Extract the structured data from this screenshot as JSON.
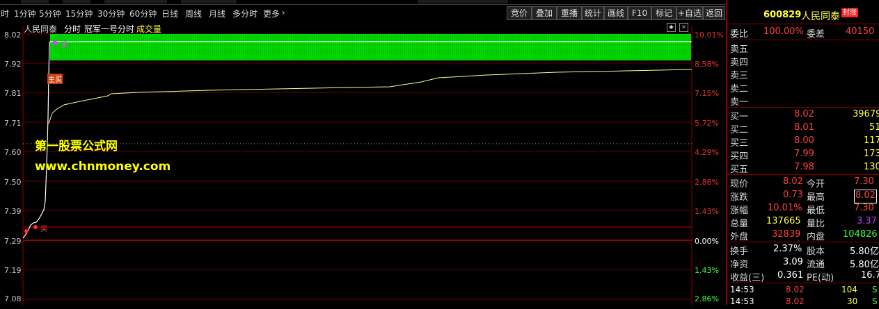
{
  "menu": {
    "prefix": "时",
    "items": [
      "1分钟",
      "5分钟",
      "15分钟",
      "30分钟",
      "60分钟",
      "日线",
      "周线",
      "月线",
      "多分时",
      "更多"
    ],
    "more_arrow": "›",
    "right_buttons": [
      "竞价",
      "叠加",
      "重播",
      "统计",
      "画线",
      "F10",
      "标记",
      "+自选",
      "返回"
    ]
  },
  "title_row": {
    "stock": "人民同泰",
    "mode": "分时",
    "indicator": "冠军一号分时",
    "volume": "成交量"
  },
  "chart": {
    "price_labels": [
      "8.02",
      "7.92",
      "7.81",
      "7.71",
      "7.60",
      "7.50",
      "7.39",
      "7.29",
      "7.19",
      "7.08"
    ],
    "pct_labels": [
      "10.01%",
      "8.58%",
      "7.15%",
      "5.72%",
      "4.29%",
      "2.86%",
      "1.43%",
      "0.00%",
      "1.43%",
      "2.86%"
    ],
    "watermark_line1": "第一股票公式网",
    "watermark_line2": "www.chnmoney.com",
    "tag_buy_main": "主买",
    "tag_top": "顶",
    "tag_buy_low": "买"
  },
  "panel": {
    "code": "600829",
    "name": "人民同泰",
    "seal": "封涨",
    "wei_bi_label": "委比",
    "wei_bi_value": "100.00%",
    "wei_cha_label": "委差",
    "wei_cha_value": "40150",
    "sell": [
      {
        "label": "卖五"
      },
      {
        "label": "卖四"
      },
      {
        "label": "卖三"
      },
      {
        "label": "卖二"
      },
      {
        "label": "卖一"
      }
    ],
    "buy": [
      {
        "label": "买一",
        "price": "8.02",
        "vol": "39679"
      },
      {
        "label": "买二",
        "price": "8.01",
        "vol": "51"
      },
      {
        "label": "买三",
        "price": "8.00",
        "vol": "117"
      },
      {
        "label": "买四",
        "price": "7.99",
        "vol": "173"
      },
      {
        "label": "买五",
        "price": "7.98",
        "vol": "130"
      }
    ],
    "stats": [
      {
        "l1": "现价",
        "v1": "8.02",
        "l2": "今开",
        "v2": "7.30"
      },
      {
        "l1": "涨跌",
        "v1": "0.73",
        "l2": "最高",
        "v2": "8.02"
      },
      {
        "l1": "涨幅",
        "v1": "10.01%",
        "l2": "最低",
        "v2": "7.30"
      },
      {
        "l1": "总量",
        "v1": "137665",
        "l2": "量比",
        "v2": "3.37"
      },
      {
        "l1": "外盘",
        "v1": "32839",
        "l2": "内盘",
        "v2": "104826"
      }
    ],
    "fund": [
      {
        "l1": "换手",
        "v1": "2.37%",
        "l2": "股本",
        "v2": "5.80亿"
      },
      {
        "l1": "净资",
        "v1": "3.09",
        "l2": "流通",
        "v2": "5.80亿"
      },
      {
        "l1": "收益(三)",
        "v1": "0.361",
        "l2": "PE(动)",
        "v2": "16.7"
      }
    ],
    "ticks": [
      {
        "time": "14:53",
        "price": "8.02",
        "vol": "104",
        "flag": "S"
      },
      {
        "time": "14:53",
        "price": "8.02",
        "vol": "30",
        "flag": "S"
      }
    ]
  },
  "colors": {
    "grid": "#8a0000",
    "fill": "#00ff00",
    "price_line": "#ffffff",
    "avg_line": "#ffff80",
    "watermark": "#ffff00"
  }
}
